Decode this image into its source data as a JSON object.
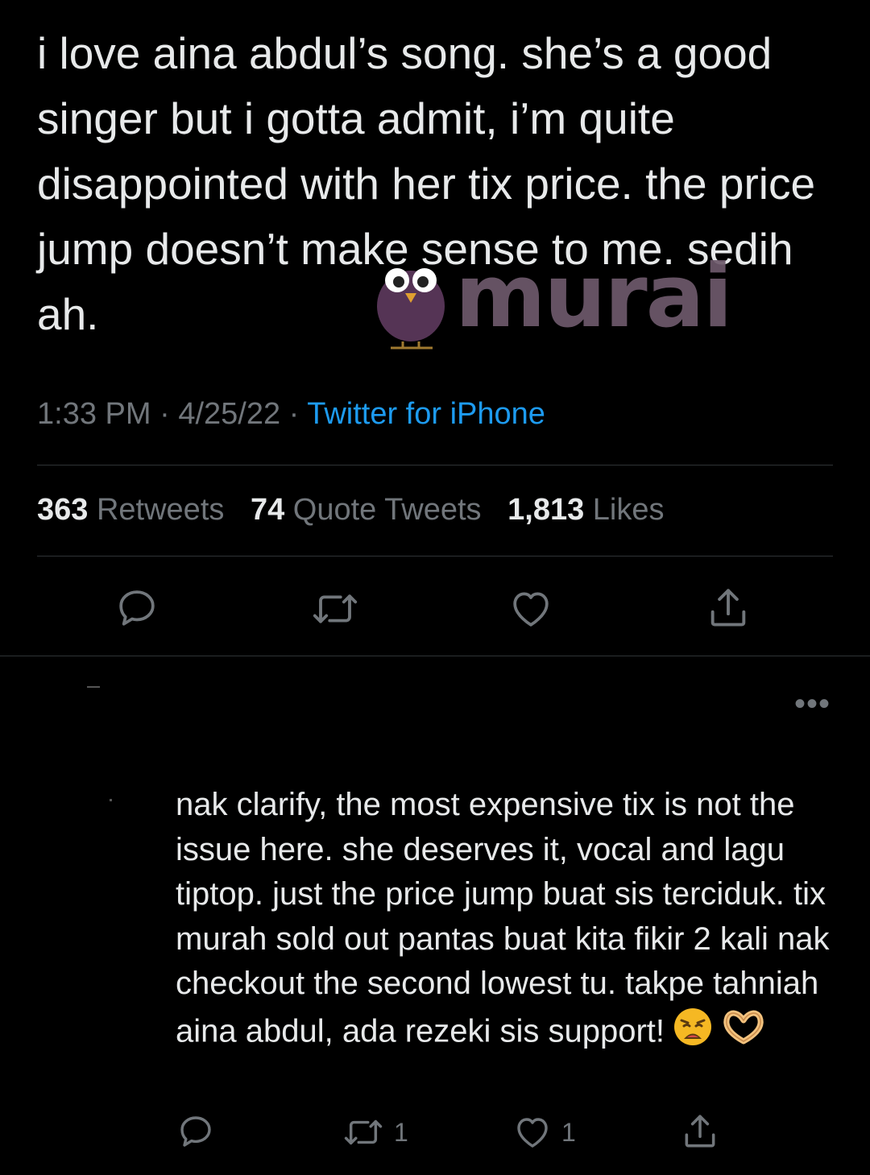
{
  "tweet": {
    "text": "i love aina abdul’s song. she’s a good singer but i gotta admit, i’m quite disappointed with her tix price. the price jump doesn’t make sense to me. sedih ah.",
    "time": "1:33 PM",
    "date": "4/25/22",
    "source": "Twitter for iPhone",
    "sep": " · "
  },
  "stats": {
    "retweets_count": "363",
    "retweets_label": "Retweets",
    "quotes_count": "74",
    "quotes_label": "Quote Tweets",
    "likes_count": "1,813",
    "likes_label": "Likes"
  },
  "watermark": {
    "text": "murai"
  },
  "reply": {
    "more": "•••",
    "text": "nak clarify, the most expensive tix is not the issue here. she deserves it, vocal and lagu tiptop. just the price jump buat sis terciduk. tix murah sold out pantas buat kita fikir 2 kali nak checkout the second lowest tu. takpe tahniah aina abdul, ada rezeki sis support!",
    "retweet_count": "1",
    "like_count": "1"
  },
  "icons": {
    "reply": "reply-icon",
    "retweet": "retweet-icon",
    "like": "heart-icon",
    "share": "share-icon"
  },
  "colors": {
    "background": "#000000",
    "text": "#e7e9ea",
    "muted": "#71767b",
    "link": "#1d9bf0",
    "divider": "#2f3336"
  }
}
